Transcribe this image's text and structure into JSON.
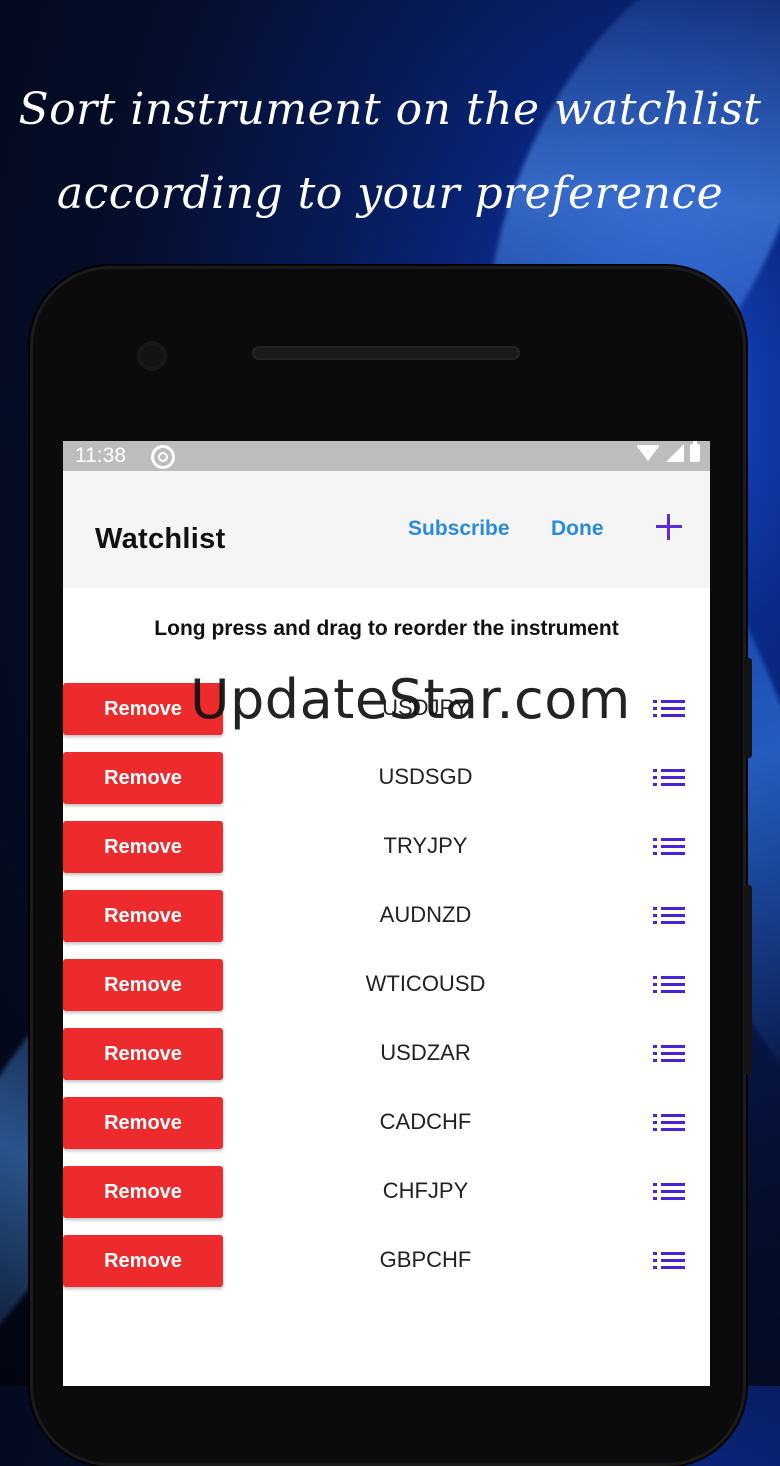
{
  "promo": {
    "line1": "Sort instrument on the watchlist",
    "line2": "according to your preference"
  },
  "status_bar": {
    "time": "11:38"
  },
  "app_bar": {
    "title": "Watchlist",
    "subscribe_label": "Subscribe",
    "done_label": "Done"
  },
  "hint": "Long press and drag to reorder the instrument",
  "remove_label": "Remove",
  "instruments": [
    {
      "symbol": "USDJPY"
    },
    {
      "symbol": "USDSGD"
    },
    {
      "symbol": "TRYJPY"
    },
    {
      "symbol": "AUDNZD"
    },
    {
      "symbol": "WTICOUSD"
    },
    {
      "symbol": "USDZAR"
    },
    {
      "symbol": "CADCHF"
    },
    {
      "symbol": "CHFJPY"
    },
    {
      "symbol": "GBPCHF"
    }
  ],
  "watermark": "UpdateStar.com",
  "colors": {
    "remove_button": "#ed2b2d",
    "link": "#2b8bd9",
    "accent": "#4a22d8"
  }
}
